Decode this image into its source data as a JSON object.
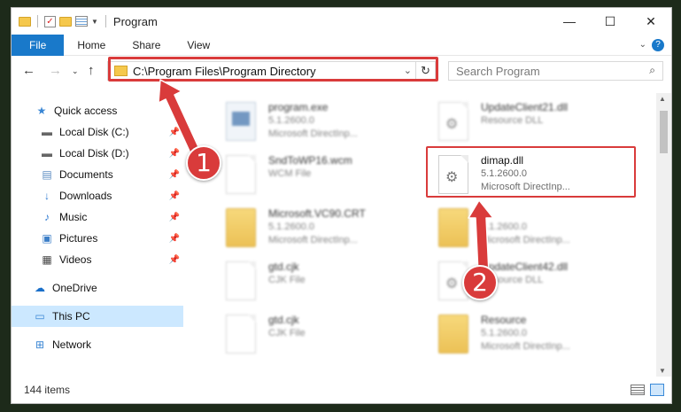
{
  "window": {
    "title": "Program"
  },
  "ribbon": {
    "tabs": [
      "File",
      "Home",
      "Share",
      "View"
    ]
  },
  "address": {
    "path": "C:\\Program Files\\Program Directory"
  },
  "search": {
    "placeholder": "Search Program"
  },
  "sidebar": {
    "items": [
      {
        "label": "Quick access",
        "icon": "star-icon",
        "pinned": false
      },
      {
        "label": "Local Disk (C:)",
        "icon": "drive-icon",
        "pinned": true
      },
      {
        "label": "Local Disk (D:)",
        "icon": "drive-icon",
        "pinned": true
      },
      {
        "label": "Documents",
        "icon": "documents-icon",
        "pinned": true
      },
      {
        "label": "Downloads",
        "icon": "download-icon",
        "pinned": true
      },
      {
        "label": "Music",
        "icon": "music-icon",
        "pinned": true
      },
      {
        "label": "Pictures",
        "icon": "pictures-icon",
        "pinned": true
      },
      {
        "label": "Videos",
        "icon": "videos-icon",
        "pinned": true
      },
      {
        "label": "OneDrive",
        "icon": "cloud-icon",
        "pinned": false
      },
      {
        "label": "This PC",
        "icon": "computer-icon",
        "pinned": false,
        "selected": true
      },
      {
        "label": "Network",
        "icon": "network-icon",
        "pinned": false
      }
    ]
  },
  "files": [
    {
      "name": "program.exe",
      "line2": "5.1.2600.0",
      "line3": "Microsoft DirectInp...",
      "kind": "exe"
    },
    {
      "name": "UpdateClient21.dll",
      "line2": "Resource DLL",
      "line3": "",
      "kind": "dll"
    },
    {
      "name": "SndToWP16.wcm",
      "line2": "WCM File",
      "line3": "",
      "kind": "doc"
    },
    {
      "name": "dimap.dll",
      "line2": "5.1.2600.0",
      "line3": "Microsoft DirectInp...",
      "kind": "dll"
    },
    {
      "name": "Microsoft.VC90.CRT",
      "line2": "5.1.2600.0",
      "line3": "Microsoft DirectInp...",
      "kind": "folder"
    },
    {
      "name": "",
      "line2": "5.1.2600.0",
      "line3": "Microsoft DirectInp...",
      "kind": "folder"
    },
    {
      "name": "gtd.cjk",
      "line2": "CJK File",
      "line3": "",
      "kind": "doc"
    },
    {
      "name": "UpdateClient42.dll",
      "line2": "Resource DLL",
      "line3": "",
      "kind": "dll"
    },
    {
      "name": "gtd.cjk",
      "line2": "CJK File",
      "line3": "",
      "kind": "doc"
    },
    {
      "name": "Resource",
      "line2": "5.1.2600.0",
      "line3": "Microsoft DirectInp...",
      "kind": "folder"
    }
  ],
  "status": {
    "count": "144 items"
  },
  "annotations": {
    "badge1": "1",
    "badge2": "2",
    "color": "#d93b3b"
  }
}
